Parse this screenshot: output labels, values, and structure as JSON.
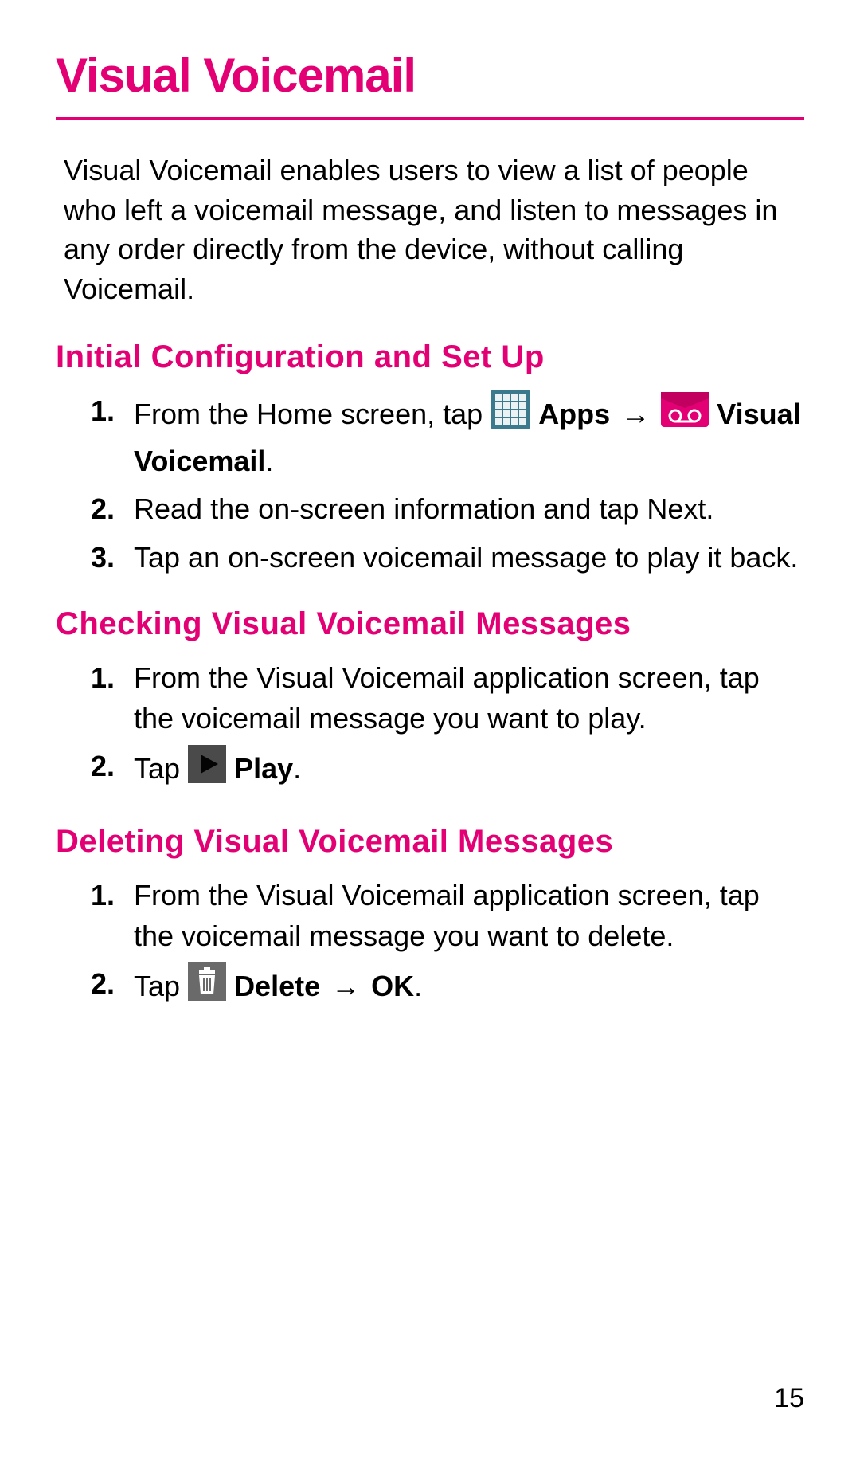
{
  "colors": {
    "magenta": "#e20074",
    "iconTeal": "#3a7a8c",
    "iconDark": "#4a4a4a",
    "iconGray": "#6a6a6a"
  },
  "page": {
    "title": "Visual Voicemail",
    "intro": "Visual Voicemail enables users to view a list of people who left a voicemail message, and listen to messages in any order directly from the device, without calling Voicemail.",
    "pageNumber": "15"
  },
  "sections": [
    {
      "heading": "Initial Configuration and Set Up",
      "steps": [
        {
          "num": "1.",
          "parts": [
            {
              "type": "text",
              "value": "From the Home screen, tap "
            },
            {
              "type": "icon",
              "value": "apps-grid-icon"
            },
            {
              "type": "text",
              "value": " "
            },
            {
              "type": "bold",
              "value": "Apps"
            },
            {
              "type": "text",
              "value": " "
            },
            {
              "type": "arrow",
              "value": "→"
            },
            {
              "type": "text",
              "value": " "
            },
            {
              "type": "icon",
              "value": "voicemail-tape-icon"
            },
            {
              "type": "text",
              "value": " "
            },
            {
              "type": "bold",
              "value": "Visual Voicemail"
            },
            {
              "type": "text",
              "value": "."
            }
          ]
        },
        {
          "num": "2.",
          "parts": [
            {
              "type": "text",
              "value": "Read the on-screen information and tap Next."
            }
          ]
        },
        {
          "num": "3.",
          "parts": [
            {
              "type": "text",
              "value": "Tap an on-screen voicemail message to play it back."
            }
          ]
        }
      ]
    },
    {
      "heading": "Checking Visual Voicemail Messages",
      "steps": [
        {
          "num": "1.",
          "parts": [
            {
              "type": "text",
              "value": "From the Visual Voicemail application screen, tap the voicemail message you want to play."
            }
          ]
        },
        {
          "num": "2.",
          "parts": [
            {
              "type": "text",
              "value": "Tap "
            },
            {
              "type": "icon",
              "value": "play-icon"
            },
            {
              "type": "text",
              "value": " "
            },
            {
              "type": "bold",
              "value": "Play"
            },
            {
              "type": "text",
              "value": "."
            }
          ]
        }
      ]
    },
    {
      "heading": "Deleting Visual Voicemail Messages",
      "steps": [
        {
          "num": "1.",
          "parts": [
            {
              "type": "text",
              "value": "From the Visual Voicemail application screen, tap the voicemail message you want to delete."
            }
          ]
        },
        {
          "num": "2.",
          "parts": [
            {
              "type": "text",
              "value": "Tap "
            },
            {
              "type": "icon",
              "value": "trash-icon"
            },
            {
              "type": "text",
              "value": " "
            },
            {
              "type": "bold",
              "value": "Delete"
            },
            {
              "type": "text",
              "value": " "
            },
            {
              "type": "arrow",
              "value": "→"
            },
            {
              "type": "text",
              "value": " "
            },
            {
              "type": "bold",
              "value": "OK"
            },
            {
              "type": "text",
              "value": "."
            }
          ]
        }
      ]
    }
  ]
}
